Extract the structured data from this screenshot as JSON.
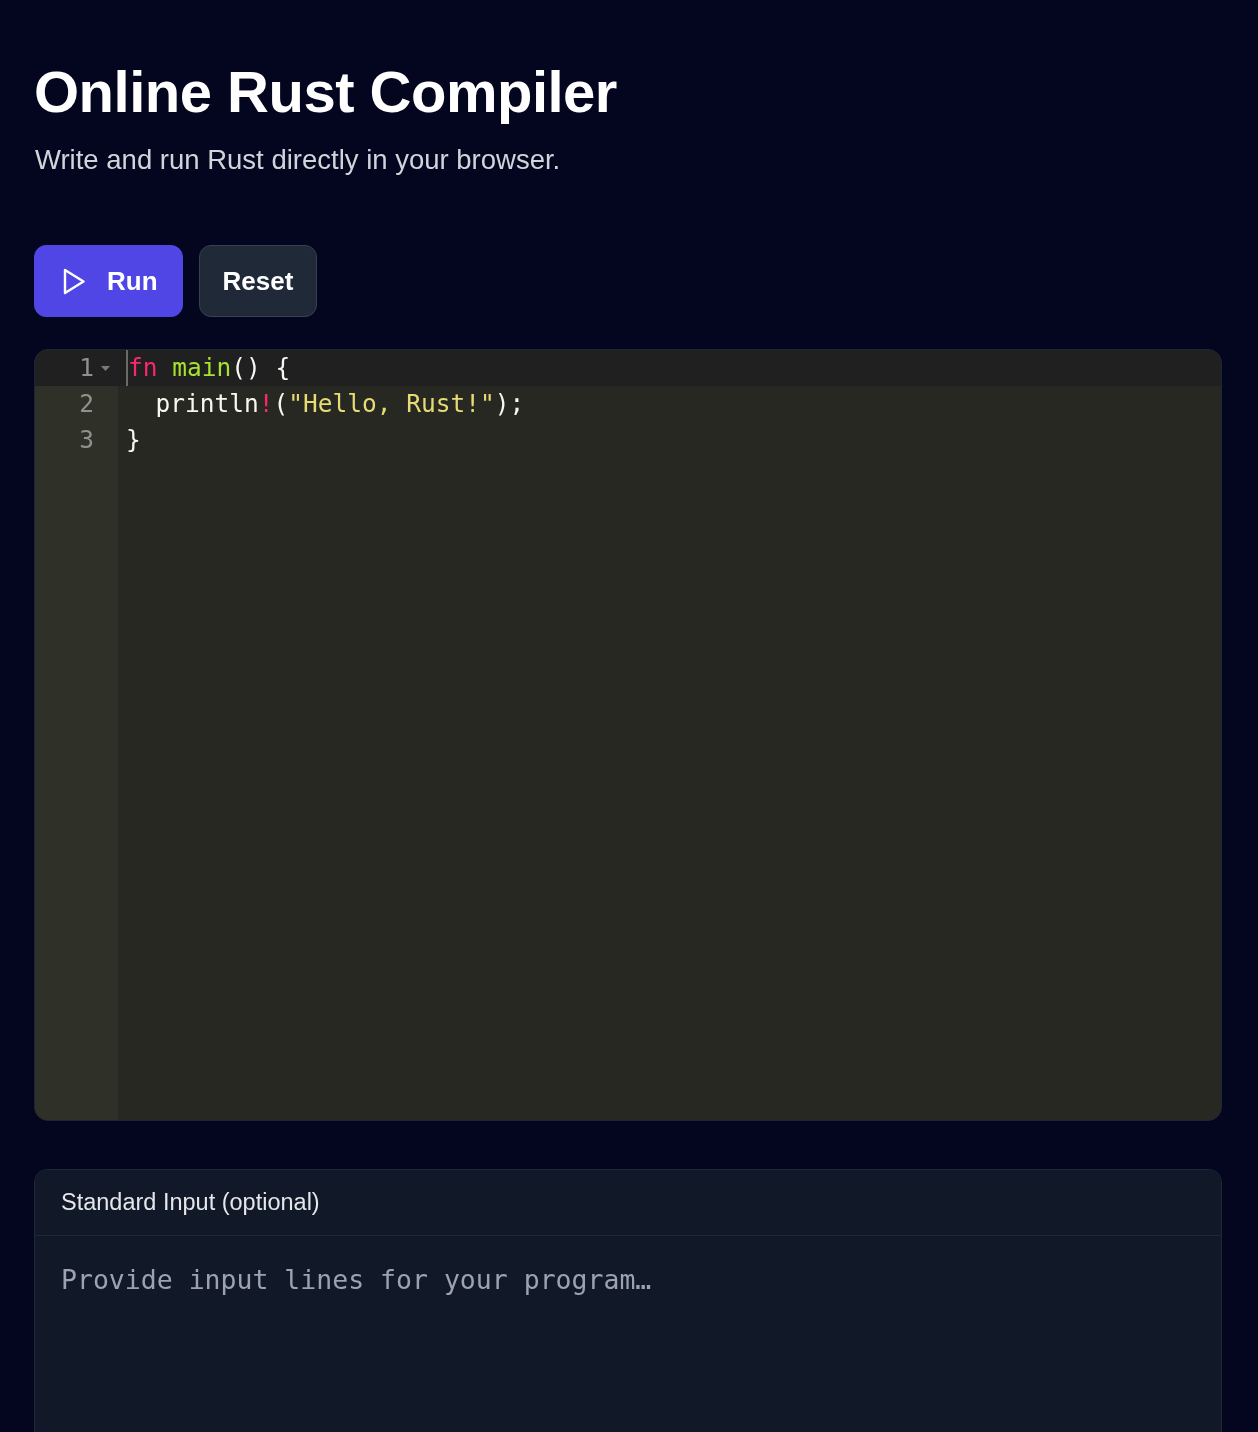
{
  "header": {
    "title": "Online Rust Compiler",
    "subtitle": "Write and run Rust directly in your browser."
  },
  "toolbar": {
    "buttons": [
      {
        "label": "Run",
        "kind": "primary"
      },
      {
        "label": "Reset",
        "kind": "secondary"
      }
    ]
  },
  "editor": {
    "lines": [
      {
        "number": "1",
        "active": true,
        "foldable": true,
        "tokens": [
          {
            "text": "fn",
            "kind": "keyword"
          },
          {
            "text": " main",
            "kind": "function"
          },
          {
            "text": "() {",
            "kind": "plain"
          }
        ]
      },
      {
        "number": "2",
        "active": false,
        "foldable": false,
        "tokens": [
          {
            "text": "  println",
            "kind": "plain"
          },
          {
            "text": "!",
            "kind": "keyword"
          },
          {
            "text": "(",
            "kind": "plain"
          },
          {
            "text": "\"Hello, Rust!\"",
            "kind": "string"
          },
          {
            "text": ");",
            "kind": "plain"
          }
        ]
      },
      {
        "number": "3",
        "active": false,
        "foldable": false,
        "tokens": [
          {
            "text": "}",
            "kind": "plain"
          }
        ]
      }
    ]
  },
  "stdin": {
    "label": "Standard Input (optional)",
    "placeholder": "Provide input lines for your program…"
  }
}
